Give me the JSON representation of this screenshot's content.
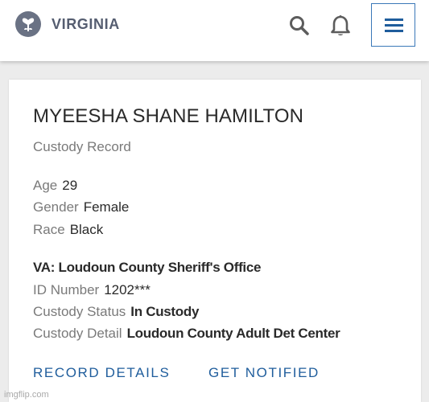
{
  "header": {
    "brand": "VIRGINIA",
    "icons": {
      "logo": "virginia-logo-icon",
      "search": "search-icon",
      "notifications": "bell-icon",
      "menu": "hamburger-menu-icon"
    }
  },
  "record": {
    "name": "MYEESHA SHANE HAMILTON",
    "subtitle": "Custody Record",
    "age_label": "Age",
    "age": "29",
    "gender_label": "Gender",
    "gender": "Female",
    "race_label": "Race",
    "race": "Black",
    "agency": "VA: Loudoun County Sheriff's Office",
    "id_label": "ID Number",
    "id": "1202***",
    "status_label": "Custody Status",
    "status": "In Custody",
    "detail_label": "Custody Detail",
    "detail": "Loudoun County Adult Det Center"
  },
  "actions": {
    "record_details": "RECORD DETAILS",
    "get_notified": "GET NOTIFIED"
  },
  "watermark": "imgflip.com",
  "colors": {
    "accent": "#1f5d9c",
    "label": "#7a7a7a",
    "text": "#2a2a2a",
    "brand": "#555d70"
  }
}
